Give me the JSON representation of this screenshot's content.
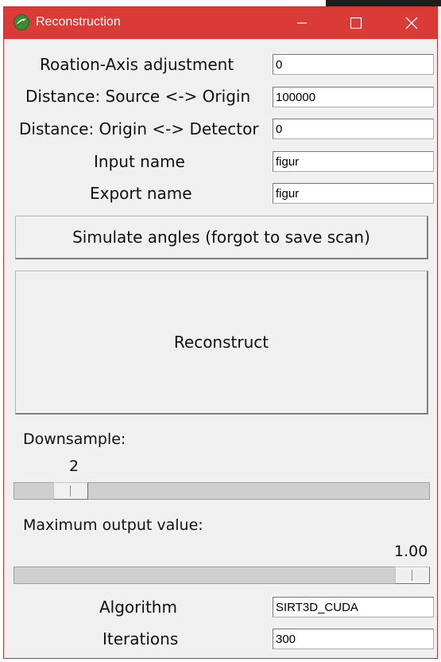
{
  "window": {
    "title": "Reconstruction"
  },
  "fields": [
    {
      "label": "Roation-Axis adjustment",
      "value": "0"
    },
    {
      "label": "Distance: Source <-> Origin",
      "value": "100000"
    },
    {
      "label": "Distance: Origin <-> Detector",
      "value": "0"
    },
    {
      "label": "Input name",
      "value": "figur"
    },
    {
      "label": "Export name",
      "value": "figur"
    }
  ],
  "buttons": {
    "simulate": "Simulate angles (forgot to save scan)",
    "reconstruct": "Reconstruct"
  },
  "downsample": {
    "label": "Downsample:",
    "value": "2",
    "level": 0.1
  },
  "max_output": {
    "label": "Maximum output value:",
    "value": "1.00",
    "level": 1.0
  },
  "algorithm": {
    "label": "Algorithm",
    "value": "SIRT3D_CUDA"
  },
  "iterations": {
    "label": "Iterations",
    "value": "300"
  }
}
